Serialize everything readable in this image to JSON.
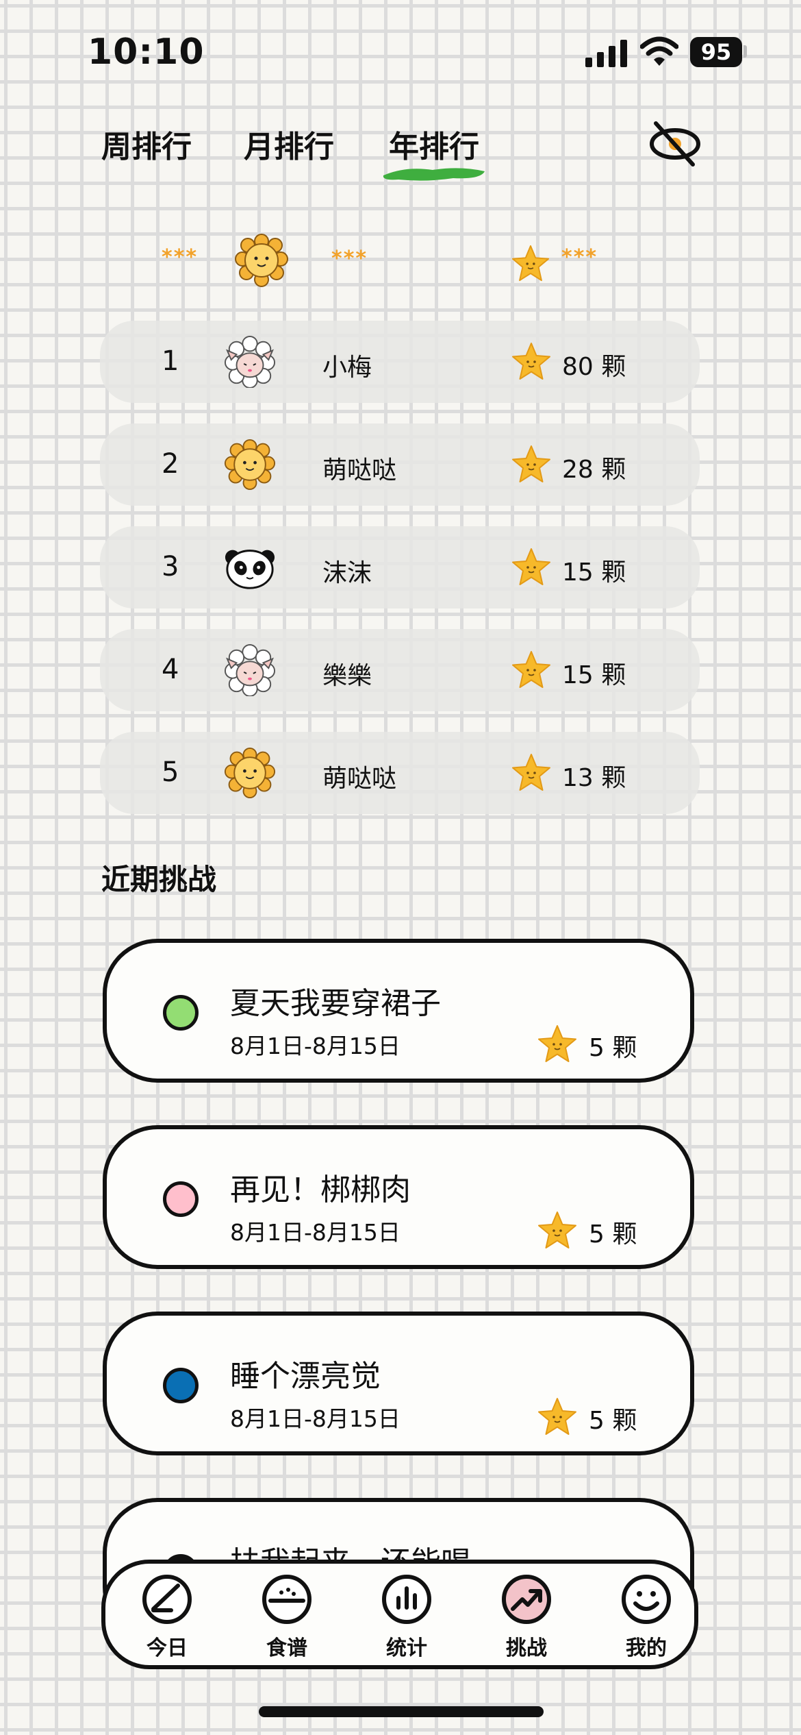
{
  "status_bar": {
    "time": "10:10",
    "battery": "95"
  },
  "tabs": [
    {
      "label": "周排行",
      "active": false
    },
    {
      "label": "月排行",
      "active": false
    },
    {
      "label": "年排行",
      "active": true
    }
  ],
  "my_row": {
    "rank": "***",
    "avatar": "lion-avatar",
    "name": "***",
    "count": "***"
  },
  "ranking": [
    {
      "rank": "1",
      "avatar": "sheep-avatar",
      "name": "小梅",
      "count": "80 颗"
    },
    {
      "rank": "2",
      "avatar": "lion-avatar",
      "name": "萌哒哒",
      "count": "28 颗"
    },
    {
      "rank": "3",
      "avatar": "panda-avatar",
      "name": "沫沫",
      "count": "15 颗"
    },
    {
      "rank": "4",
      "avatar": "sheep-avatar",
      "name": "樂樂",
      "count": "15 颗"
    },
    {
      "rank": "5",
      "avatar": "lion-avatar",
      "name": "萌哒哒",
      "count": "13 颗"
    }
  ],
  "section_title": "近期挑战",
  "challenges": [
    {
      "title": "夏天我要穿裙子",
      "date": "8月1日-8月15日",
      "count": "5 颗",
      "color": "#93dd73"
    },
    {
      "title": "再见！梆梆肉",
      "date": "8月1日-8月15日",
      "count": "5 颗",
      "color": "#ffbfcc"
    },
    {
      "title": "睡个漂亮觉",
      "date": "8月1日-8月15日",
      "count": "5 颗",
      "color": "#0a6fb4"
    },
    {
      "title": "扶我起来，还能喝",
      "date": "",
      "count": "",
      "color": "#111111"
    }
  ],
  "nav": [
    {
      "label": "今日",
      "icon": "pencil-circle-icon"
    },
    {
      "label": "食谱",
      "icon": "rice-bowl-icon"
    },
    {
      "label": "统计",
      "icon": "bar-chart-icon"
    },
    {
      "label": "挑战",
      "icon": "trend-arrow-icon",
      "active": true
    },
    {
      "label": "我的",
      "icon": "smile-icon"
    }
  ],
  "colors": {
    "star": "#f7b92a",
    "accent_green": "#3fae3f",
    "rank_mask": "#f2a22a"
  }
}
